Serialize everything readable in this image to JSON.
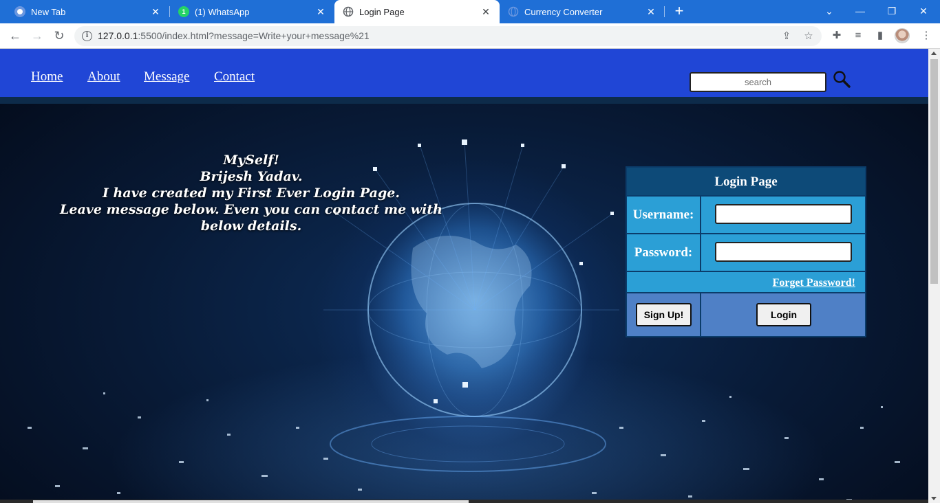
{
  "browser": {
    "tabs": [
      {
        "title": "New Tab",
        "icon": "chrome-icon"
      },
      {
        "title": "(1) WhatsApp",
        "icon": "whatsapp-icon",
        "badge": "1"
      },
      {
        "title": "Login Page",
        "icon": "globe-icon",
        "active": true
      },
      {
        "title": "Currency Converter",
        "icon": "globe-icon"
      }
    ],
    "address_bar": {
      "host": "127.0.0.1",
      "rest": ":5500/index.html?message=Write+your+message%21"
    }
  },
  "page": {
    "nav": {
      "links": [
        "Home",
        "About",
        "Message",
        "Contact"
      ],
      "search_placeholder": "search"
    },
    "intro": {
      "lines": [
        "MySelf!",
        "Brijesh Yadav.",
        "I have created my First Ever Login Page.",
        "Leave message below. Even you can contact me with below details."
      ]
    },
    "login": {
      "title": "Login Page",
      "username_label": "Username:",
      "password_label": "Password:",
      "username_value": "",
      "password_value": "",
      "forget_link": "Forget Password!",
      "signup_button": "Sign Up!",
      "login_button": "Login"
    }
  },
  "colors": {
    "tabstrip": "#1f6fd6",
    "navbar": "#2046d6",
    "login_header": "#0d4a78",
    "login_cells": "#2b9fd6",
    "login_actions": "#4f80c6"
  }
}
